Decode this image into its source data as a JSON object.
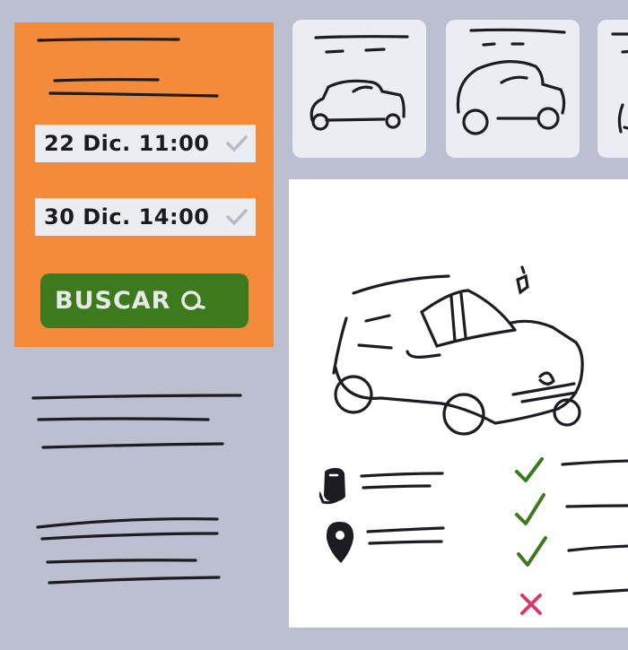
{
  "search": {
    "pickup_datetime": "22 Dic. 11:00",
    "return_datetime": "30 Dic. 14:00",
    "button_label": "BUSCAR",
    "button_icon": "search-icon"
  },
  "car_options": [
    {
      "name": "car-option-1",
      "icon": "car-icon"
    },
    {
      "name": "car-option-2",
      "icon": "car-icon"
    },
    {
      "name": "car-option-3",
      "icon": "car-icon"
    }
  ],
  "features": [
    {
      "icon": "fuel-pump-icon"
    },
    {
      "icon": "location-pin-icon"
    }
  ],
  "checklist": [
    {
      "status": "check"
    },
    {
      "status": "check"
    },
    {
      "status": "check"
    },
    {
      "status": "cross"
    }
  ],
  "colors": {
    "accent_orange": "#f48b3a",
    "button_green": "#3d7a1e",
    "check_green": "#3d7a1e",
    "cross_red": "#d43a6a",
    "background": "#bcbfcf"
  }
}
